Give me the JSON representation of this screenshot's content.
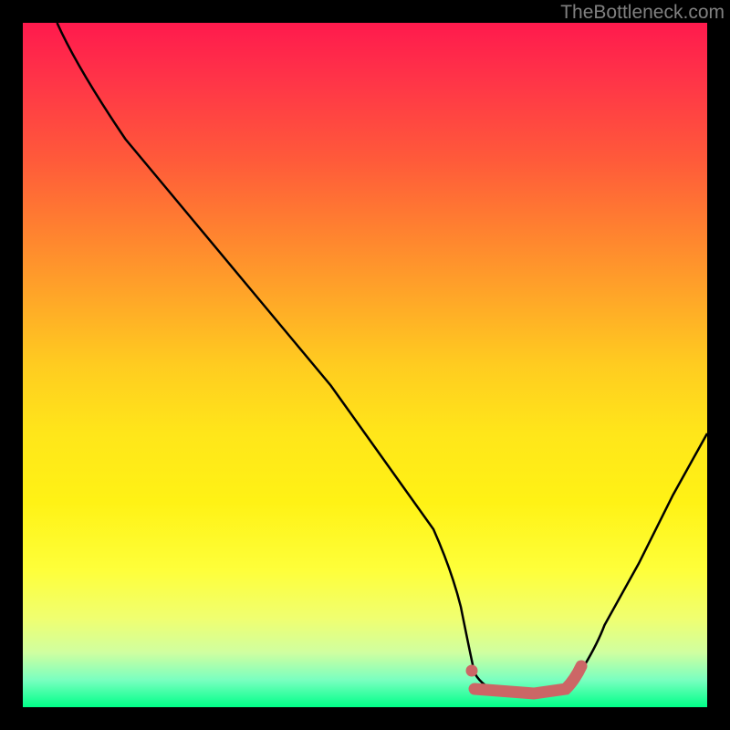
{
  "watermark": "TheBottleneck.com",
  "chart_data": {
    "type": "line",
    "title": "",
    "xlabel": "",
    "ylabel": "",
    "xlim": [
      0,
      100
    ],
    "ylim": [
      0,
      100
    ],
    "series": [
      {
        "name": "bottleneck-curve",
        "color": "#000000",
        "x": [
          5,
          10,
          15,
          20,
          25,
          30,
          35,
          40,
          45,
          50,
          55,
          60,
          62,
          65,
          70,
          75,
          78,
          80,
          85,
          90,
          95,
          100
        ],
        "y": [
          100,
          92,
          83,
          74,
          65,
          56,
          47,
          38,
          30,
          22,
          15,
          8,
          5,
          2,
          2,
          2,
          3,
          5,
          12,
          21,
          30,
          40
        ]
      }
    ],
    "highlight": {
      "name": "optimal-range",
      "color": "#cc6666",
      "x_start": 62,
      "x_end": 78,
      "y": 2,
      "marker_x": 62,
      "marker_y": 5
    },
    "background_gradient": {
      "top_color": "#ff1a4d",
      "middle_color": "#ffe61a",
      "bottom_color": "#00ff88"
    }
  }
}
